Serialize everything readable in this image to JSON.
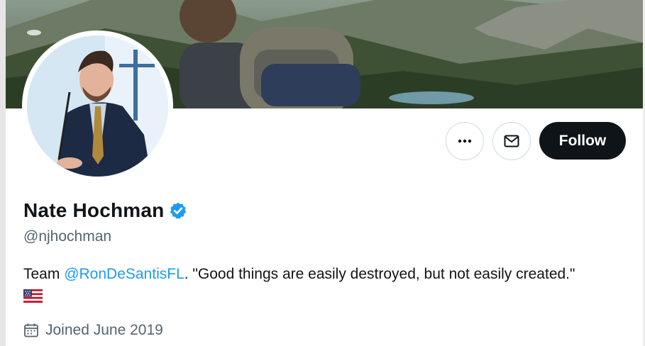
{
  "profile": {
    "name": "Nate Hochman",
    "handle": "@njhochman",
    "bio": {
      "prefix": "Team ",
      "mention": "@RonDeSantisFL",
      "suffix": ". \"Good things are easily destroyed, but not easily created.\""
    },
    "joined": "Joined June 2019",
    "verified": true
  },
  "actions": {
    "follow_label": "Follow"
  },
  "icons": {
    "more": "more-horizontal-icon",
    "message": "envelope-icon",
    "verified": "verified-badge-icon",
    "calendar": "calendar-icon",
    "flag": "us-flag-icon"
  },
  "colors": {
    "accent": "#1d9bf0",
    "text": "#0f1419",
    "secondary_text": "#536471",
    "follow_bg": "#0f1419"
  }
}
